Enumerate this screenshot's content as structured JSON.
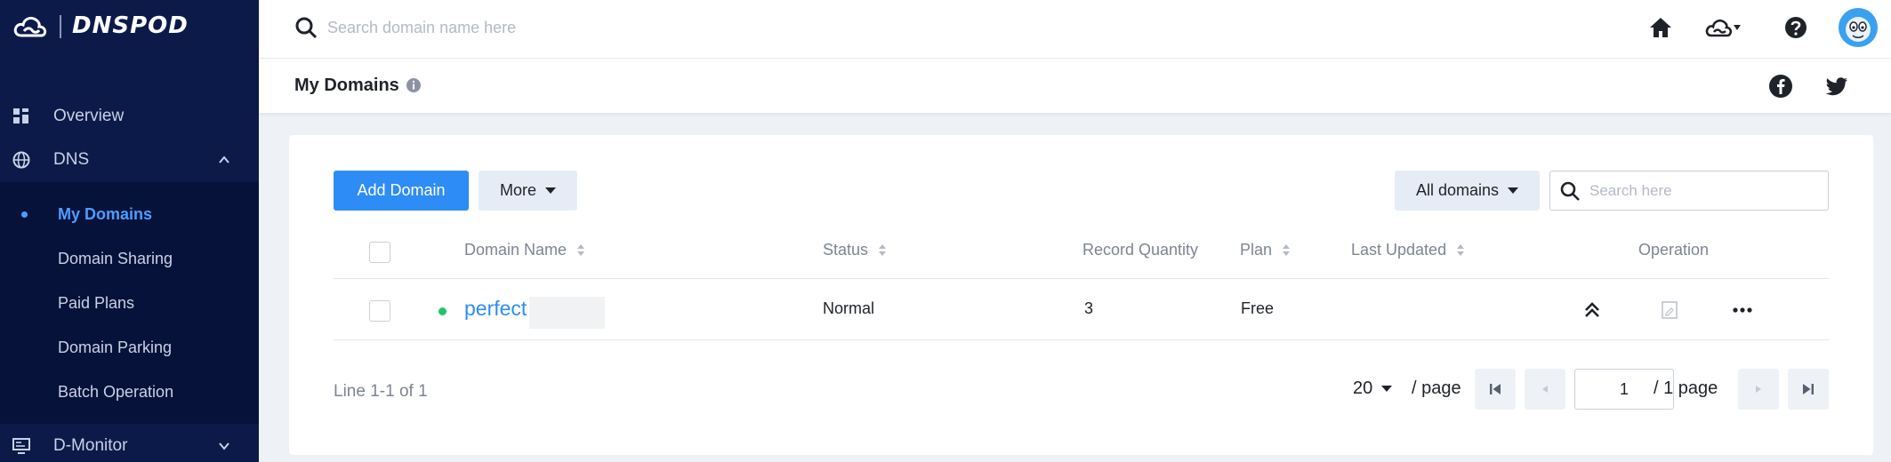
{
  "brand": {
    "name": "DNSPOD"
  },
  "sidebar": {
    "items": [
      {
        "label": "Overview",
        "icon": "dashboard-icon"
      },
      {
        "label": "DNS",
        "icon": "globe-icon",
        "expanded": true
      },
      {
        "label": "D-Monitor",
        "icon": "monitor-icon",
        "expanded": false
      }
    ],
    "dns_submenu": [
      {
        "label": "My Domains",
        "active": true
      },
      {
        "label": "Domain Sharing"
      },
      {
        "label": "Paid Plans"
      },
      {
        "label": "Domain Parking"
      },
      {
        "label": "Batch Operation"
      }
    ]
  },
  "topbar": {
    "search_placeholder": "Search domain name here",
    "icons": [
      "home-icon",
      "cloud-icon",
      "help-icon",
      "avatar"
    ]
  },
  "page": {
    "title": "My Domains",
    "social": [
      "facebook-icon",
      "twitter-icon"
    ]
  },
  "toolbar": {
    "add_label": "Add Domain",
    "more_label": "More",
    "filter_label": "All domains",
    "search_placeholder": "Search here"
  },
  "table": {
    "columns": [
      "Domain Name",
      "Status",
      "Record Quantity",
      "Plan",
      "Last Updated",
      "Operation"
    ],
    "rows": [
      {
        "domain": "perfect",
        "status": "Normal",
        "records": "3",
        "plan": "Free",
        "last_updated": ""
      }
    ]
  },
  "pagination": {
    "total_text": "Line 1-1 of 1",
    "page_size": "20",
    "per_page_label": "/ page",
    "current_page": "1",
    "total_pages_label": "/ 1 page"
  },
  "colors": {
    "sidebar_bg": "#0c1a4a",
    "submenu_bg": "#07123a",
    "accent": "#2d8cf6",
    "status_normal": "#1ec66b"
  }
}
